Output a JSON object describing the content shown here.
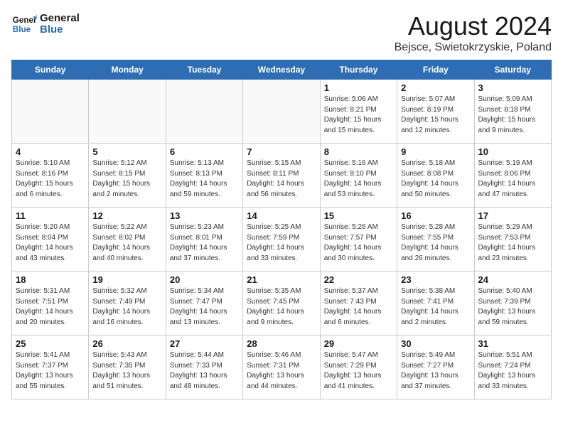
{
  "header": {
    "logo_line1": "General",
    "logo_line2": "Blue",
    "month_year": "August 2024",
    "location": "Bejsce, Swietokrzyskie, Poland"
  },
  "days_of_week": [
    "Sunday",
    "Monday",
    "Tuesday",
    "Wednesday",
    "Thursday",
    "Friday",
    "Saturday"
  ],
  "weeks": [
    [
      {
        "day": "",
        "info": ""
      },
      {
        "day": "",
        "info": ""
      },
      {
        "day": "",
        "info": ""
      },
      {
        "day": "",
        "info": ""
      },
      {
        "day": "1",
        "info": "Sunrise: 5:06 AM\nSunset: 8:21 PM\nDaylight: 15 hours\nand 15 minutes."
      },
      {
        "day": "2",
        "info": "Sunrise: 5:07 AM\nSunset: 8:19 PM\nDaylight: 15 hours\nand 12 minutes."
      },
      {
        "day": "3",
        "info": "Sunrise: 5:09 AM\nSunset: 8:18 PM\nDaylight: 15 hours\nand 9 minutes."
      }
    ],
    [
      {
        "day": "4",
        "info": "Sunrise: 5:10 AM\nSunset: 8:16 PM\nDaylight: 15 hours\nand 6 minutes."
      },
      {
        "day": "5",
        "info": "Sunrise: 5:12 AM\nSunset: 8:15 PM\nDaylight: 15 hours\nand 2 minutes."
      },
      {
        "day": "6",
        "info": "Sunrise: 5:13 AM\nSunset: 8:13 PM\nDaylight: 14 hours\nand 59 minutes."
      },
      {
        "day": "7",
        "info": "Sunrise: 5:15 AM\nSunset: 8:11 PM\nDaylight: 14 hours\nand 56 minutes."
      },
      {
        "day": "8",
        "info": "Sunrise: 5:16 AM\nSunset: 8:10 PM\nDaylight: 14 hours\nand 53 minutes."
      },
      {
        "day": "9",
        "info": "Sunrise: 5:18 AM\nSunset: 8:08 PM\nDaylight: 14 hours\nand 50 minutes."
      },
      {
        "day": "10",
        "info": "Sunrise: 5:19 AM\nSunset: 8:06 PM\nDaylight: 14 hours\nand 47 minutes."
      }
    ],
    [
      {
        "day": "11",
        "info": "Sunrise: 5:20 AM\nSunset: 8:04 PM\nDaylight: 14 hours\nand 43 minutes."
      },
      {
        "day": "12",
        "info": "Sunrise: 5:22 AM\nSunset: 8:02 PM\nDaylight: 14 hours\nand 40 minutes."
      },
      {
        "day": "13",
        "info": "Sunrise: 5:23 AM\nSunset: 8:01 PM\nDaylight: 14 hours\nand 37 minutes."
      },
      {
        "day": "14",
        "info": "Sunrise: 5:25 AM\nSunset: 7:59 PM\nDaylight: 14 hours\nand 33 minutes."
      },
      {
        "day": "15",
        "info": "Sunrise: 5:26 AM\nSunset: 7:57 PM\nDaylight: 14 hours\nand 30 minutes."
      },
      {
        "day": "16",
        "info": "Sunrise: 5:28 AM\nSunset: 7:55 PM\nDaylight: 14 hours\nand 26 minutes."
      },
      {
        "day": "17",
        "info": "Sunrise: 5:29 AM\nSunset: 7:53 PM\nDaylight: 14 hours\nand 23 minutes."
      }
    ],
    [
      {
        "day": "18",
        "info": "Sunrise: 5:31 AM\nSunset: 7:51 PM\nDaylight: 14 hours\nand 20 minutes."
      },
      {
        "day": "19",
        "info": "Sunrise: 5:32 AM\nSunset: 7:49 PM\nDaylight: 14 hours\nand 16 minutes."
      },
      {
        "day": "20",
        "info": "Sunrise: 5:34 AM\nSunset: 7:47 PM\nDaylight: 14 hours\nand 13 minutes."
      },
      {
        "day": "21",
        "info": "Sunrise: 5:35 AM\nSunset: 7:45 PM\nDaylight: 14 hours\nand 9 minutes."
      },
      {
        "day": "22",
        "info": "Sunrise: 5:37 AM\nSunset: 7:43 PM\nDaylight: 14 hours\nand 6 minutes."
      },
      {
        "day": "23",
        "info": "Sunrise: 5:38 AM\nSunset: 7:41 PM\nDaylight: 14 hours\nand 2 minutes."
      },
      {
        "day": "24",
        "info": "Sunrise: 5:40 AM\nSunset: 7:39 PM\nDaylight: 13 hours\nand 59 minutes."
      }
    ],
    [
      {
        "day": "25",
        "info": "Sunrise: 5:41 AM\nSunset: 7:37 PM\nDaylight: 13 hours\nand 55 minutes."
      },
      {
        "day": "26",
        "info": "Sunrise: 5:43 AM\nSunset: 7:35 PM\nDaylight: 13 hours\nand 51 minutes."
      },
      {
        "day": "27",
        "info": "Sunrise: 5:44 AM\nSunset: 7:33 PM\nDaylight: 13 hours\nand 48 minutes."
      },
      {
        "day": "28",
        "info": "Sunrise: 5:46 AM\nSunset: 7:31 PM\nDaylight: 13 hours\nand 44 minutes."
      },
      {
        "day": "29",
        "info": "Sunrise: 5:47 AM\nSunset: 7:29 PM\nDaylight: 13 hours\nand 41 minutes."
      },
      {
        "day": "30",
        "info": "Sunrise: 5:49 AM\nSunset: 7:27 PM\nDaylight: 13 hours\nand 37 minutes."
      },
      {
        "day": "31",
        "info": "Sunrise: 5:51 AM\nSunset: 7:24 PM\nDaylight: 13 hours\nand 33 minutes."
      }
    ]
  ]
}
